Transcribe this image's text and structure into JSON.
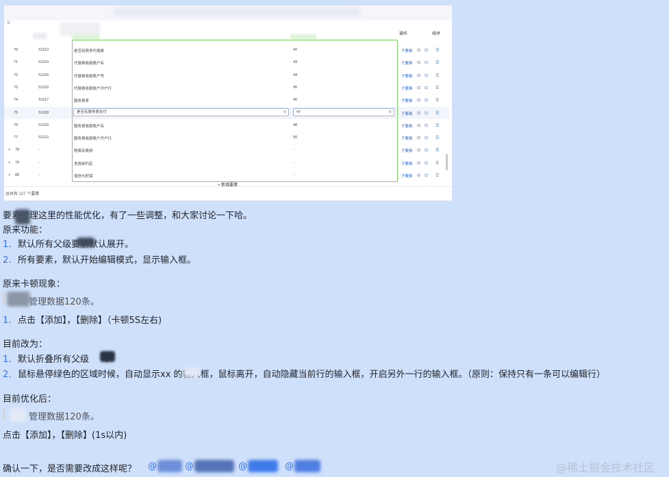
{
  "screenshot": {
    "corner_char": "⇅",
    "headers": {
      "operation": "操作",
      "sort": "排序"
    },
    "rows": [
      {
        "idx": "70",
        "code": "S1113",
        "name": "是否有债务代偿费",
        "seq": "42",
        "op": "子要素",
        "expand": ""
      },
      {
        "idx": "71",
        "code": "S1114",
        "name": "代偿费收款账户名",
        "seq": "43",
        "op": "子要素",
        "expand": ""
      },
      {
        "idx": "72",
        "code": "S1115",
        "name": "代偿费收款账户号",
        "seq": "44",
        "op": "子要素",
        "expand": ""
      },
      {
        "idx": "73",
        "code": "S1116",
        "name": "代偿费收款账户开户行",
        "seq": "45",
        "op": "子要素",
        "expand": ""
      },
      {
        "idx": "74",
        "code": "S1117",
        "name": "服务费率",
        "seq": "46",
        "op": "子要素",
        "expand": ""
      },
      {
        "idx": "75",
        "code": "S1118",
        "name": "是否有服务费支付",
        "seq": "47",
        "op": "子要素",
        "expand": "",
        "editing": true
      },
      {
        "idx": "76",
        "code": "S1119",
        "name": "服务费收款账户名",
        "seq": "48",
        "op": "子要素",
        "expand": ""
      },
      {
        "idx": "77",
        "code": "S1121",
        "name": "服务费收款账户开户行",
        "seq": "50",
        "op": "子要素",
        "expand": ""
      },
      {
        "idx": "78",
        "code": "-",
        "name": "税费及费用",
        "seq": "-",
        "op": "子要素",
        "expand": "+"
      },
      {
        "idx": "79",
        "code": "-",
        "name": "发放前约定",
        "seq": "-",
        "op": "子要素",
        "expand": "+"
      },
      {
        "idx": "80",
        "code": "-",
        "name": "增信与担保",
        "seq": "-",
        "op": "子要素",
        "expand": "+"
      }
    ],
    "row_icons": [
      "⊟",
      "⊡",
      "☰"
    ],
    "input_clear_icon": "⊗",
    "add_label": "+ 新增要素",
    "total_text": "总共有 127 个要素"
  },
  "message": {
    "line1": "要素管理这里的性能优化，有了一些调整，和大家讨论一下哈。",
    "original_feature_title": "原来功能：",
    "original_features": [
      {
        "num": "1.",
        "text": "默认所有父级要素默认展开。"
      },
      {
        "num": "2.",
        "text": "所有要素，默认开始编辑模式，显示输入框。"
      }
    ],
    "lag_title": "原来卡顿现象：",
    "lag_quote": "管理数据120条。",
    "lag_items": [
      {
        "num": "1.",
        "text": "点击【添加】，【删除】（卡顿5S左右)"
      }
    ],
    "changed_title": "目前改为：",
    "changed_items": [
      {
        "num": "1.",
        "text": "默认折叠所有父级"
      },
      {
        "num": "2.",
        "text": "鼠标悬停绿色的区域时候，自动显示xx      的输入框，鼠标离开，自动隐藏当前行的输入框，开启另外一行的输入框。（原则：保持只有一条可以编辑行）"
      }
    ],
    "optimized_title": "目前优化后：",
    "optimized_quote": "管理数据120条。",
    "optimized_result": "点击【添加】，【删除】(1s以内)",
    "confirm": "确认一下，是否需要改成这样呢？",
    "mentions": [
      "@",
      "@",
      "@",
      "@"
    ]
  },
  "watermark": "@稀土掘金技术社区",
  "colors": {
    "background": "#cfe0fa",
    "accent_blue": "#3370ff",
    "green_region": "#7ed06a"
  }
}
